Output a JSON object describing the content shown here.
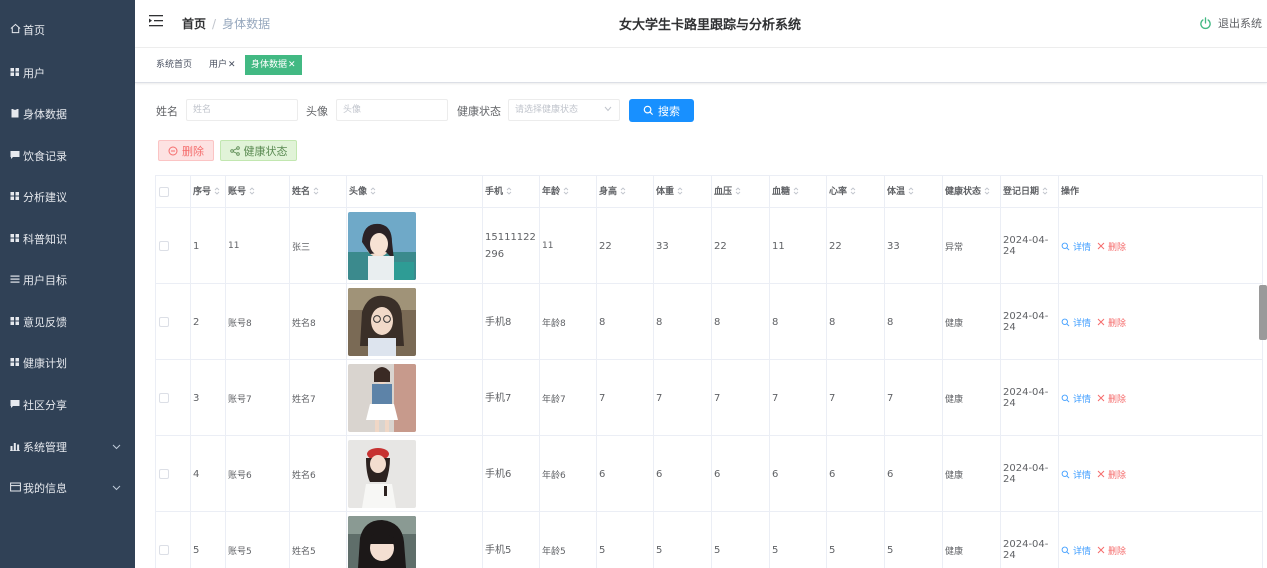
{
  "sidebar": {
    "items": [
      {
        "label": "首页",
        "icon": "home-icon"
      },
      {
        "label": "用户",
        "icon": "grid-icon"
      },
      {
        "label": "身体数据",
        "icon": "clipboard-icon"
      },
      {
        "label": "饮食记录",
        "icon": "message-icon"
      },
      {
        "label": "分析建议",
        "icon": "grid-icon"
      },
      {
        "label": "科普知识",
        "icon": "grid-icon"
      },
      {
        "label": "用户目标",
        "icon": "list-icon"
      },
      {
        "label": "意见反馈",
        "icon": "grid-icon"
      },
      {
        "label": "健康计划",
        "icon": "grid-icon"
      },
      {
        "label": "社区分享",
        "icon": "message-icon"
      },
      {
        "label": "系统管理",
        "icon": "chart-icon",
        "expandable": true
      },
      {
        "label": "我的信息",
        "icon": "card-icon",
        "expandable": true
      }
    ]
  },
  "header": {
    "breadcrumb_home": "首页",
    "breadcrumb_sep": "/",
    "breadcrumb_current": "身体数据",
    "title": "女大学生卡路里跟踪与分析系统",
    "logout": "退出系统"
  },
  "tags": [
    {
      "label": "系统首页",
      "closable": false,
      "active": false
    },
    {
      "label": "用户",
      "closable": true,
      "active": false
    },
    {
      "label": "身体数据",
      "closable": true,
      "active": true
    }
  ],
  "search": {
    "name_label": "姓名",
    "name_placeholder": "姓名",
    "avatar_label": "头像",
    "avatar_placeholder": "头像",
    "status_label": "健康状态",
    "status_placeholder": "请选择健康状态",
    "button": "搜索"
  },
  "actions": {
    "delete": "删除",
    "health_status": "健康状态"
  },
  "table": {
    "columns": [
      "序号",
      "账号",
      "姓名",
      "头像",
      "手机",
      "年龄",
      "身高",
      "体重",
      "血压",
      "血糖",
      "心率",
      "体温",
      "健康状态",
      "登记日期",
      "操作"
    ],
    "detail_label": "详情",
    "delete_label": "删除",
    "rows": [
      {
        "no": "1",
        "account": "11",
        "name": "张三",
        "phone": "15111122296",
        "age": "11",
        "height": "22",
        "weight": "33",
        "bp": "22",
        "sugar": "11",
        "heart": "22",
        "temp": "33",
        "status": "异常",
        "date": "2024-04-24"
      },
      {
        "no": "2",
        "account": "账号8",
        "name": "姓名8",
        "phone": "手机8",
        "age": "年龄8",
        "height": "8",
        "weight": "8",
        "bp": "8",
        "sugar": "8",
        "heart": "8",
        "temp": "8",
        "status": "健康",
        "date": "2024-04-24"
      },
      {
        "no": "3",
        "account": "账号7",
        "name": "姓名7",
        "phone": "手机7",
        "age": "年龄7",
        "height": "7",
        "weight": "7",
        "bp": "7",
        "sugar": "7",
        "heart": "7",
        "temp": "7",
        "status": "健康",
        "date": "2024-04-24"
      },
      {
        "no": "4",
        "account": "账号6",
        "name": "姓名6",
        "phone": "手机6",
        "age": "年龄6",
        "height": "6",
        "weight": "6",
        "bp": "6",
        "sugar": "6",
        "heart": "6",
        "temp": "6",
        "status": "健康",
        "date": "2024-04-24"
      },
      {
        "no": "5",
        "account": "账号5",
        "name": "姓名5",
        "phone": "手机5",
        "age": "年龄5",
        "height": "5",
        "weight": "5",
        "bp": "5",
        "sugar": "5",
        "heart": "5",
        "temp": "5",
        "status": "健康",
        "date": "2024-04-24"
      }
    ]
  },
  "colors": {
    "sidebar_bg": "#304156",
    "active_tag": "#42b983",
    "primary": "#1890ff",
    "danger": "#f56c6c"
  }
}
